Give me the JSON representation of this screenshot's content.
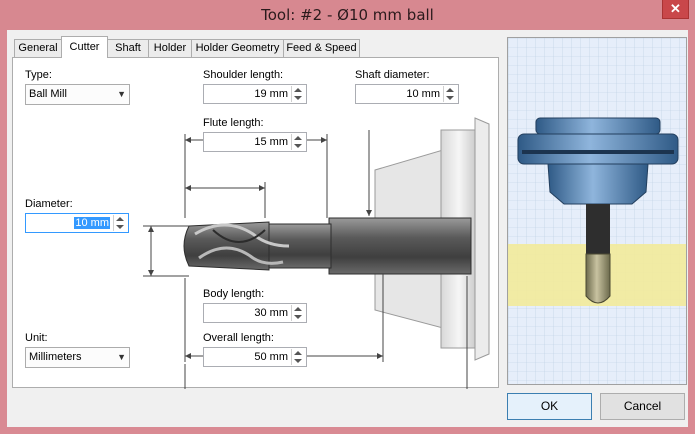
{
  "window": {
    "title": "Tool: #2 - Ø10 mm ball",
    "close_glyph": "✕"
  },
  "tabs": [
    {
      "label": "General"
    },
    {
      "label": "Cutter"
    },
    {
      "label": "Shaft"
    },
    {
      "label": "Holder"
    },
    {
      "label": "Holder Geometry"
    },
    {
      "label": "Feed & Speed"
    }
  ],
  "active_tab": "Cutter",
  "cutter": {
    "type_label": "Type:",
    "type_value": "Ball Mill",
    "shoulder_length_label": "Shoulder length:",
    "shoulder_length_value": "19 mm",
    "shaft_diameter_label": "Shaft diameter:",
    "shaft_diameter_value": "10 mm",
    "flute_length_label": "Flute length:",
    "flute_length_value": "15 mm",
    "diameter_label": "Diameter:",
    "diameter_value": "10 mm",
    "body_length_label": "Body length:",
    "body_length_value": "30 mm",
    "overall_length_label": "Overall length:",
    "overall_length_value": "50 mm",
    "unit_label": "Unit:",
    "unit_value": "Millimeters"
  },
  "buttons": {
    "ok_label": "OK",
    "cancel_label": "Cancel"
  },
  "colors": {
    "title_bar": "#d78890",
    "selection": "#3399ff",
    "preview_highlight": "#f2ea9a",
    "holder_blue": "#4e7fae",
    "tool_dark": "#3d3d3d",
    "tool_tip": "#a8a080"
  }
}
